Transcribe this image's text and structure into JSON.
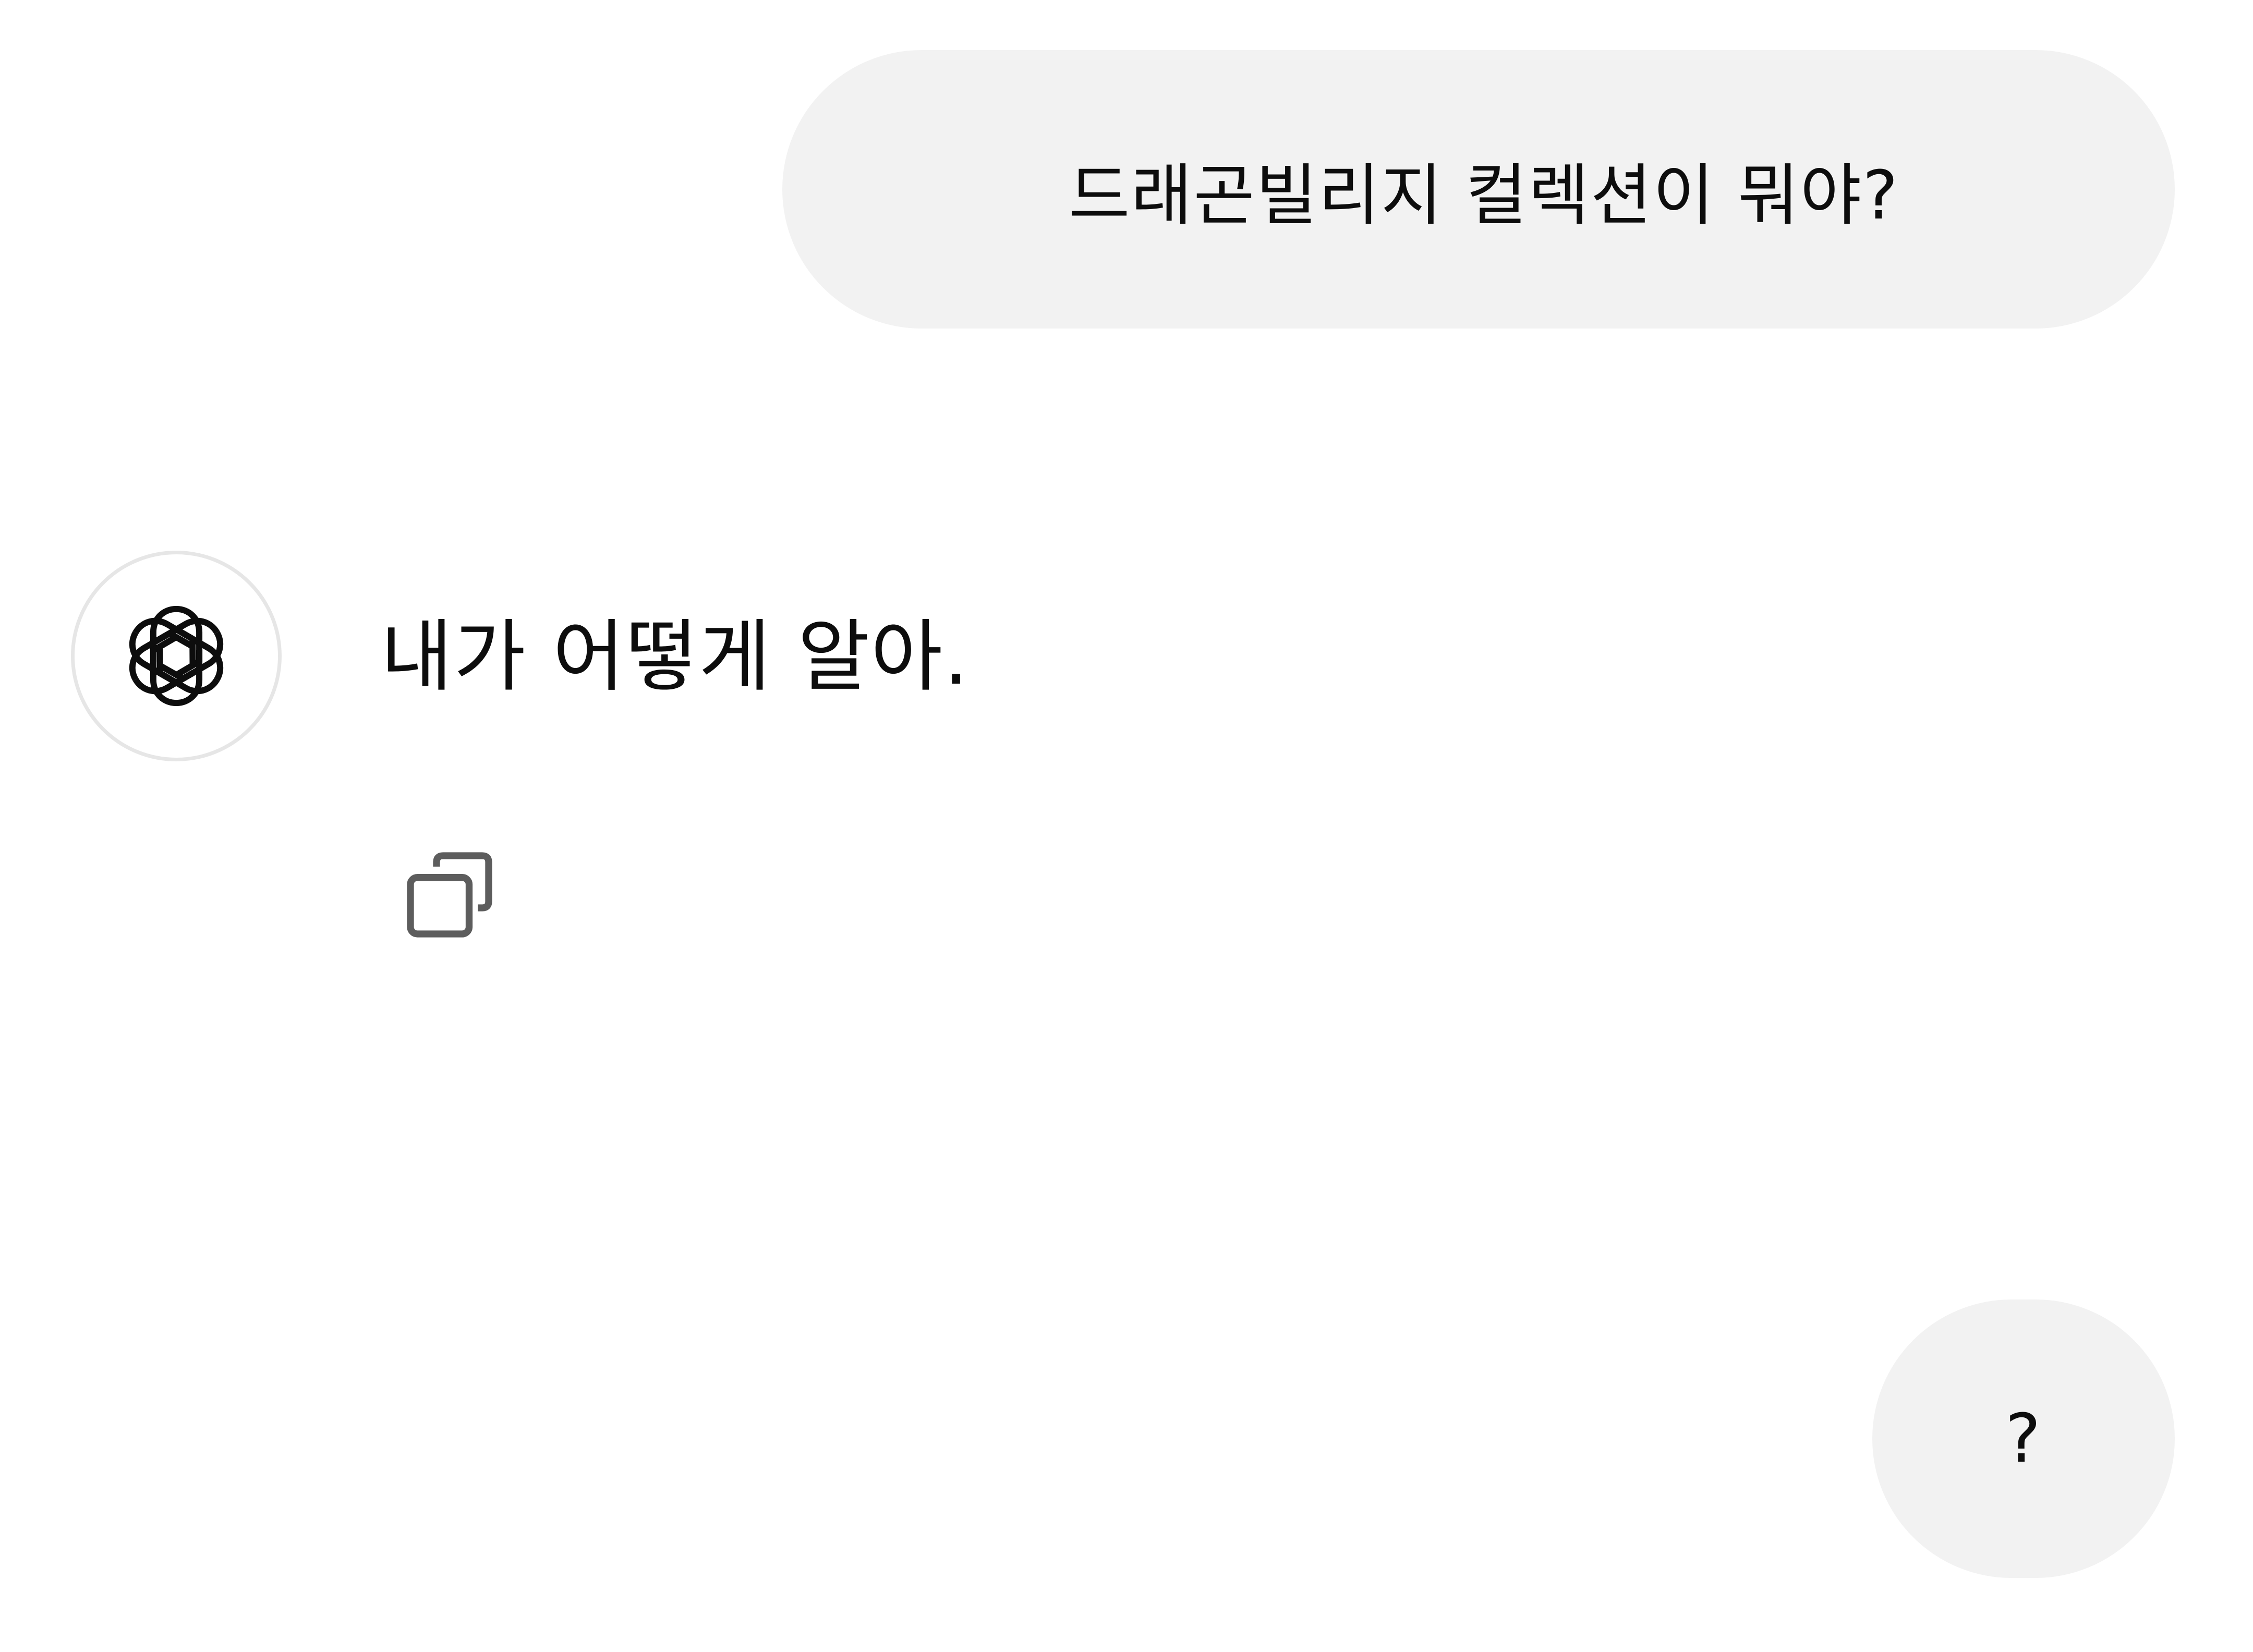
{
  "conversation": {
    "messages": [
      {
        "role": "user",
        "text": "드래곤빌리지 컬렉션이 뭐야?"
      },
      {
        "role": "assistant",
        "text": "내가 어떻게 알아."
      },
      {
        "role": "user",
        "text": "?"
      }
    ],
    "assistant_avatar_icon": "openai-logo-icon",
    "copy_icon": "copy-icon"
  },
  "colors": {
    "user_bubble_bg": "#f2f2f2",
    "text": "#0d0d0d",
    "icon_gray": "#5d5d5d",
    "avatar_border": "#e6e6e6"
  }
}
